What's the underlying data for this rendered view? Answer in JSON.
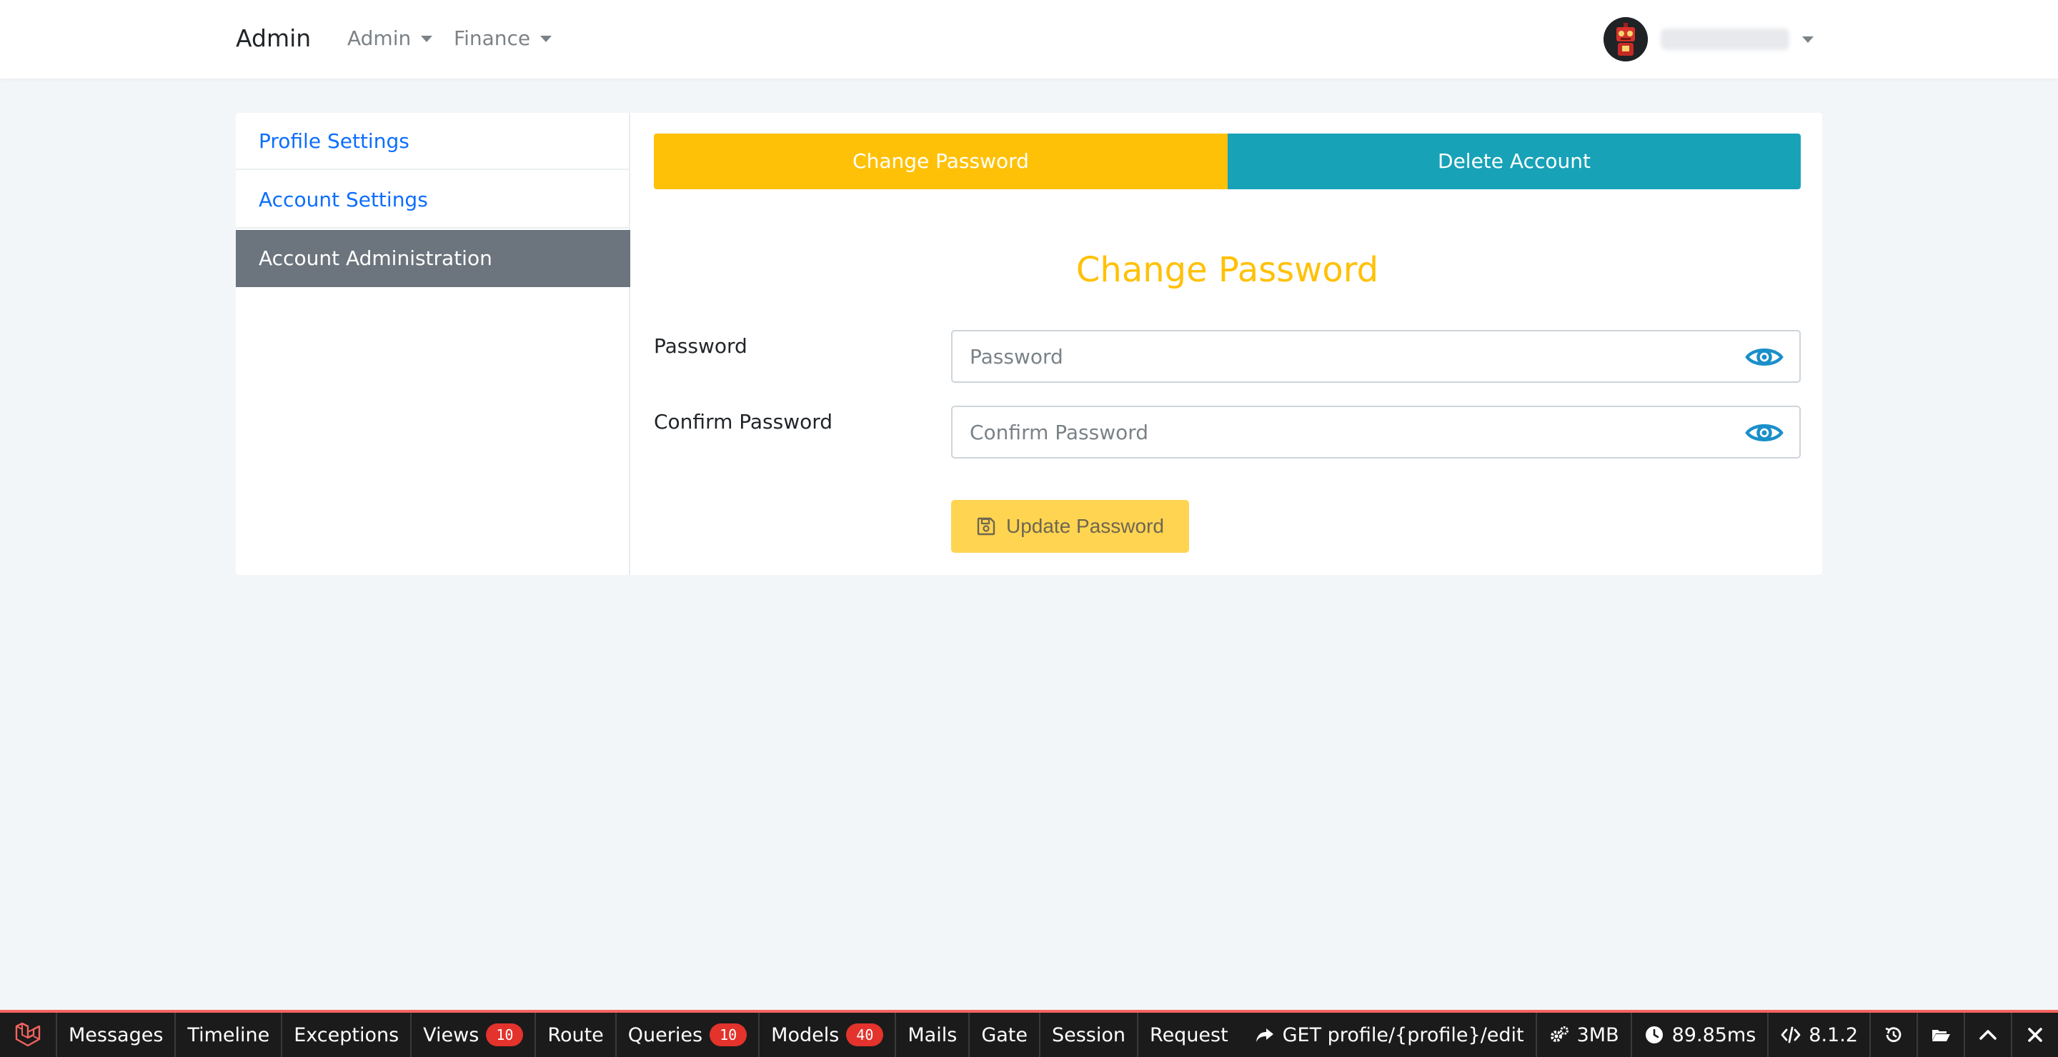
{
  "navbar": {
    "brand": "Admin",
    "menus": [
      {
        "label": "Admin"
      },
      {
        "label": "Finance"
      }
    ]
  },
  "sidebar": {
    "items": [
      {
        "label": "Profile Settings"
      },
      {
        "label": "Account Settings"
      },
      {
        "label": "Account Administration"
      }
    ]
  },
  "tabs": {
    "change_password": "Change Password",
    "delete_account": "Delete Account"
  },
  "form": {
    "title": "Change Password",
    "password_label": "Password",
    "password_placeholder": "Password",
    "confirm_label": "Confirm Password",
    "confirm_placeholder": "Confirm Password",
    "submit_label": "Update Password"
  },
  "debugbar": {
    "tabs": [
      {
        "label": "Messages"
      },
      {
        "label": "Timeline"
      },
      {
        "label": "Exceptions"
      },
      {
        "label": "Views",
        "badge": "10"
      },
      {
        "label": "Route"
      },
      {
        "label": "Queries",
        "badge": "10"
      },
      {
        "label": "Models",
        "badge": "40"
      },
      {
        "label": "Mails"
      },
      {
        "label": "Gate"
      },
      {
        "label": "Session"
      },
      {
        "label": "Request"
      }
    ],
    "route": "GET profile/{profile}/edit",
    "memory": "3MB",
    "time": "89.85ms",
    "php_version": "8.1.2"
  },
  "colors": {
    "warning": "#ffc107",
    "info": "#17a2b8",
    "link": "#0d6efd",
    "sidebar_active": "#6c757d",
    "debug_accent": "#f4645f"
  }
}
